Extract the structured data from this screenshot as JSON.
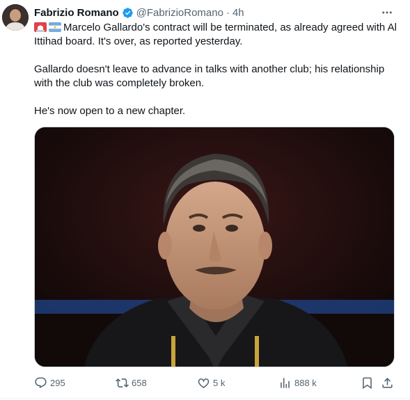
{
  "author": {
    "name": "Fabrizio Romano",
    "handle": "@FabrizioRomano",
    "separator": "·",
    "time": "4h"
  },
  "tweet": {
    "paragraphs": [
      "Marcelo Gallardo's contract will be terminated, as already agreed with Al Ittihad board. It's over, as reported yesterday.",
      "Gallardo doesn't leave to advance in talks with another club; his relationship with the club was completely broken.",
      "He's now open to a new chapter."
    ],
    "leading_emojis": [
      "siren-emoji",
      "argentina-flag-emoji"
    ]
  },
  "actions": {
    "replies": "295",
    "retweets": "658",
    "likes": "5 k",
    "views": "888 k"
  },
  "colors": {
    "verified_blue": "#1d9bf0",
    "secondary_text": "#536471",
    "primary_text": "#0f1419"
  }
}
